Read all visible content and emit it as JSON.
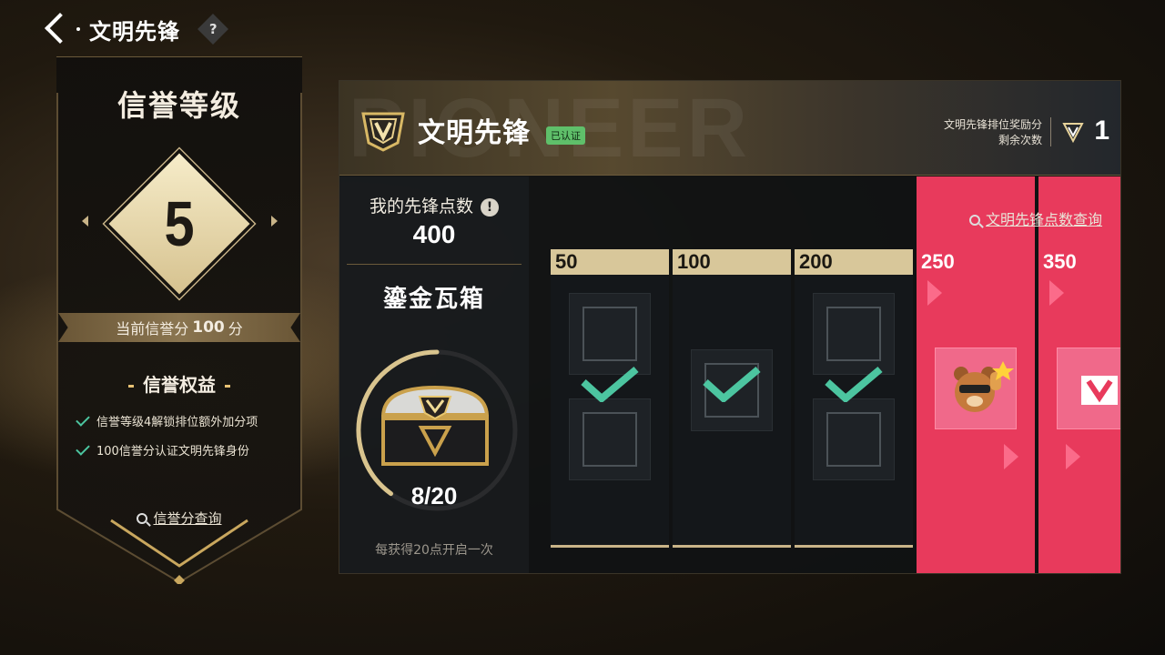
{
  "header": {
    "title": "文明先锋",
    "help_label": "?"
  },
  "credit": {
    "title": "信誉等级",
    "level": "5",
    "score_prefix": "当前信誉分",
    "score_value": "100",
    "score_suffix": "分",
    "benefits_title": "信誉权益",
    "benefits": [
      "信誉等级4解锁排位额外加分项",
      "100信誉分认证文明先锋身份"
    ],
    "query_label": "信誉分查询"
  },
  "pioneer": {
    "banner_bg_text": "PIONEER",
    "title": "文明先锋",
    "verified_badge": "已认证",
    "reward_label_line1": "文明先锋排位奖励分",
    "reward_label_line2": "剩余次数",
    "reward_count": "1"
  },
  "points": {
    "label": "我的先锋点数",
    "info_label": "!",
    "value": "400",
    "chest_name": "鎏金瓦箱",
    "chest_progress": "8/20",
    "chest_progress_fraction": 0.4,
    "chest_hint": "每获得20点开启一次",
    "query_label": "文明先锋点数查询"
  },
  "milestones": [
    {
      "label": "50",
      "status": "claimed"
    },
    {
      "label": "100",
      "status": "claimed"
    },
    {
      "label": "200",
      "status": "claimed"
    },
    {
      "label": "250",
      "status": "available"
    },
    {
      "label": "350",
      "status": "available"
    }
  ],
  "colors": {
    "gold": "#d8c79a",
    "accent_pink": "#e83a5c",
    "check_green": "#4cc5a0",
    "verified_green": "#5fbf6a"
  }
}
